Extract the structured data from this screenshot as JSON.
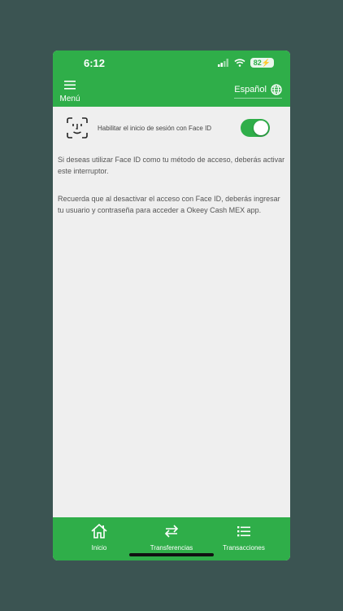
{
  "status_bar": {
    "time": "6:12",
    "battery": "82"
  },
  "header": {
    "menu_label": "Menú",
    "language_label": "Español"
  },
  "settings": {
    "faceid_label": "Habilitar el inicio de sesión con Face ID",
    "faceid_enabled": true,
    "info_paragraph_1": "Si deseas utilizar Face ID como tu método de acceso, deberás activar este interruptor.",
    "info_paragraph_2": "Recuerda que al desactivar el acceso con Face ID, deberás ingresar tu usuario y contraseña para acceder a Okeey Cash MEX app."
  },
  "tabbar": {
    "items": [
      {
        "label": "Inicio",
        "icon": "home-icon"
      },
      {
        "label": "Transferencias",
        "icon": "transfer-arrows-icon"
      },
      {
        "label": "Transacciones",
        "icon": "list-icon"
      }
    ]
  },
  "colors": {
    "brand_green": "#2fae49",
    "background": "#3b5452",
    "content_bg": "#efefef"
  }
}
